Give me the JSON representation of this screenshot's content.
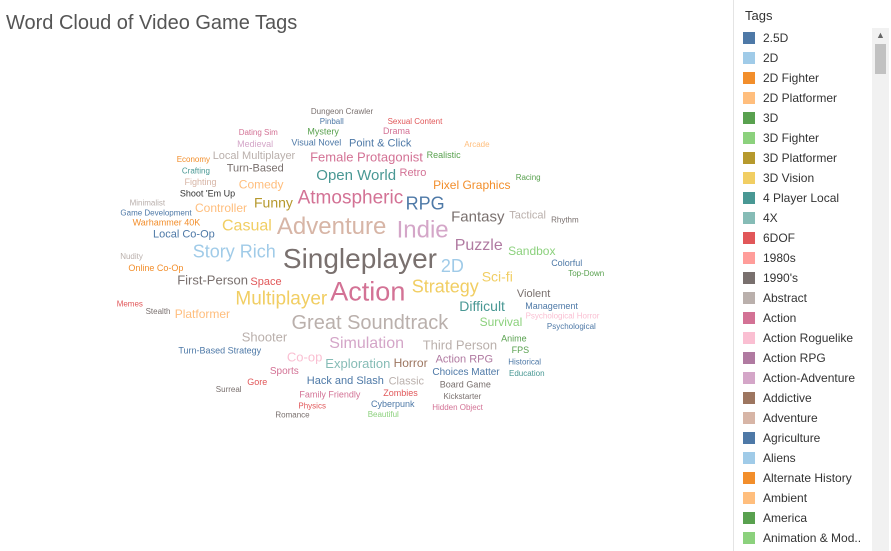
{
  "chart_data": {
    "type": "wordcloud",
    "title": "Word Cloud of Video Game Tags",
    "legend_title": "Tags",
    "legend": [
      {
        "label": "2.5D",
        "color": "#4e79a7"
      },
      {
        "label": "2D",
        "color": "#a0cbe8"
      },
      {
        "label": "2D Fighter",
        "color": "#f28e2b"
      },
      {
        "label": "2D Platformer",
        "color": "#ffbe7d"
      },
      {
        "label": "3D",
        "color": "#59a14f"
      },
      {
        "label": "3D Fighter",
        "color": "#8cd17d"
      },
      {
        "label": "3D Platformer",
        "color": "#b6992d"
      },
      {
        "label": "3D Vision",
        "color": "#f1ce63"
      },
      {
        "label": "4 Player Local",
        "color": "#499894"
      },
      {
        "label": "4X",
        "color": "#86bcb6"
      },
      {
        "label": "6DOF",
        "color": "#e15759"
      },
      {
        "label": "1980s",
        "color": "#ff9d9a"
      },
      {
        "label": "1990's",
        "color": "#79706e"
      },
      {
        "label": "Abstract",
        "color": "#bab0ac"
      },
      {
        "label": "Action",
        "color": "#d37295"
      },
      {
        "label": "Action Roguelike",
        "color": "#fabfd2"
      },
      {
        "label": "Action RPG",
        "color": "#b07aa1"
      },
      {
        "label": "Action-Adventure",
        "color": "#d4a6c8"
      },
      {
        "label": "Addictive",
        "color": "#9d7660"
      },
      {
        "label": "Adventure",
        "color": "#d7b5a6"
      },
      {
        "label": "Agriculture",
        "color": "#4e79a7"
      },
      {
        "label": "Aliens",
        "color": "#a0cbe8"
      },
      {
        "label": "Alternate History",
        "color": "#f28e2b"
      },
      {
        "label": "Ambient",
        "color": "#ffbe7d"
      },
      {
        "label": "America",
        "color": "#59a14f"
      },
      {
        "label": "Animation & Mod..",
        "color": "#8cd17d"
      }
    ],
    "words": [
      {
        "text": "Singleplayer",
        "size": 28,
        "color": "#79706e"
      },
      {
        "text": "Action",
        "size": 27,
        "color": "#d37295"
      },
      {
        "text": "Adventure",
        "size": 24,
        "color": "#d7b5a6"
      },
      {
        "text": "Indie",
        "size": 24,
        "color": "#d4a6c8"
      },
      {
        "text": "Great Soundtrack",
        "size": 20,
        "color": "#bab0ac"
      },
      {
        "text": "Multiplayer",
        "size": 19,
        "color": "#f1ce63"
      },
      {
        "text": "Atmospheric",
        "size": 19,
        "color": "#d37295"
      },
      {
        "text": "Strategy",
        "size": 18,
        "color": "#f1ce63"
      },
      {
        "text": "2D",
        "size": 18,
        "color": "#a0cbe8"
      },
      {
        "text": "Story Rich",
        "size": 18,
        "color": "#a0cbe8"
      },
      {
        "text": "RPG",
        "size": 18,
        "color": "#4e79a7"
      },
      {
        "text": "Puzzle",
        "size": 16,
        "color": "#b07aa1"
      },
      {
        "text": "Simulation",
        "size": 16,
        "color": "#d4a6c8"
      },
      {
        "text": "Casual",
        "size": 16,
        "color": "#f1ce63"
      },
      {
        "text": "Open World",
        "size": 15,
        "color": "#499894"
      },
      {
        "text": "Fantasy",
        "size": 15,
        "color": "#79706e"
      },
      {
        "text": "Funny",
        "size": 14,
        "color": "#b6992d"
      },
      {
        "text": "Sci-fi",
        "size": 14,
        "color": "#f1ce63"
      },
      {
        "text": "Difficult",
        "size": 14,
        "color": "#499894"
      },
      {
        "text": "First-Person",
        "size": 13,
        "color": "#79706e"
      },
      {
        "text": "Exploration",
        "size": 13,
        "color": "#86bcb6"
      },
      {
        "text": "Shooter",
        "size": 13,
        "color": "#bab0ac"
      },
      {
        "text": "Female Protagonist",
        "size": 13,
        "color": "#d37295"
      },
      {
        "text": "Third Person",
        "size": 13,
        "color": "#bab0ac"
      },
      {
        "text": "Co-op",
        "size": 13,
        "color": "#fabfd2"
      },
      {
        "text": "Comedy",
        "size": 12,
        "color": "#ffbe7d"
      },
      {
        "text": "Pixel Graphics",
        "size": 12,
        "color": "#f28e2b"
      },
      {
        "text": "Controller",
        "size": 12,
        "color": "#ffbe7d"
      },
      {
        "text": "Survival",
        "size": 12,
        "color": "#8cd17d"
      },
      {
        "text": "Platformer",
        "size": 12,
        "color": "#ffbe7d"
      },
      {
        "text": "Sandbox",
        "size": 12,
        "color": "#8cd17d"
      },
      {
        "text": "Horror",
        "size": 12,
        "color": "#9d7660"
      },
      {
        "text": "Action RPG",
        "size": 11,
        "color": "#b07aa1"
      },
      {
        "text": "Violent",
        "size": 11,
        "color": "#79706e"
      },
      {
        "text": "Hack and Slash",
        "size": 11,
        "color": "#4e79a7"
      },
      {
        "text": "Local Co-Op",
        "size": 11,
        "color": "#4e79a7"
      },
      {
        "text": "Turn-Based",
        "size": 11,
        "color": "#79706e"
      },
      {
        "text": "Tactical",
        "size": 11,
        "color": "#bab0ac"
      },
      {
        "text": "Space",
        "size": 11,
        "color": "#e15759"
      },
      {
        "text": "Retro",
        "size": 11,
        "color": "#d37295"
      },
      {
        "text": "Point & Click",
        "size": 11,
        "color": "#4e79a7"
      },
      {
        "text": "Classic",
        "size": 11,
        "color": "#bab0ac"
      },
      {
        "text": "Local Multiplayer",
        "size": 11,
        "color": "#bab0ac"
      },
      {
        "text": "Choices Matter",
        "size": 10,
        "color": "#4e79a7"
      },
      {
        "text": "Sports",
        "size": 10,
        "color": "#d37295"
      },
      {
        "text": "Shoot 'Em Up",
        "size": 9,
        "color": "#333333"
      },
      {
        "text": "Turn-Based Strategy",
        "size": 9,
        "color": "#4e79a7"
      },
      {
        "text": "Realistic",
        "size": 9,
        "color": "#59a14f"
      },
      {
        "text": "Visual Novel",
        "size": 9,
        "color": "#4e79a7"
      },
      {
        "text": "Management",
        "size": 9,
        "color": "#4e79a7"
      },
      {
        "text": "Anime",
        "size": 9,
        "color": "#59a14f"
      },
      {
        "text": "Zombies",
        "size": 9,
        "color": "#e15759"
      },
      {
        "text": "Family Friendly",
        "size": 9,
        "color": "#d37295"
      },
      {
        "text": "Online Co-Op",
        "size": 9,
        "color": "#f28e2b"
      },
      {
        "text": "Warhammer 40K",
        "size": 9,
        "color": "#f28e2b"
      },
      {
        "text": "Fighting",
        "size": 9,
        "color": "#d7b5a6"
      },
      {
        "text": "Colorful",
        "size": 9,
        "color": "#4e79a7"
      },
      {
        "text": "FPS",
        "size": 9,
        "color": "#59a14f"
      },
      {
        "text": "Gore",
        "size": 9,
        "color": "#e15759"
      },
      {
        "text": "Mystery",
        "size": 9,
        "color": "#59a14f"
      },
      {
        "text": "Drama",
        "size": 9,
        "color": "#d37295"
      },
      {
        "text": "Board Game",
        "size": 9,
        "color": "#79706e"
      },
      {
        "text": "Medieval",
        "size": 9,
        "color": "#d4a6c8"
      },
      {
        "text": "Cyberpunk",
        "size": 9,
        "color": "#4e79a7"
      },
      {
        "text": "Stealth",
        "size": 8,
        "color": "#79706e"
      },
      {
        "text": "Racing",
        "size": 8,
        "color": "#59a14f"
      },
      {
        "text": "Rhythm",
        "size": 8,
        "color": "#79706e"
      },
      {
        "text": "Psychological Horror",
        "size": 8,
        "color": "#fabfd2"
      },
      {
        "text": "Game Development",
        "size": 8,
        "color": "#4e79a7"
      },
      {
        "text": "Crafting",
        "size": 8,
        "color": "#499894"
      },
      {
        "text": "Arcade",
        "size": 8,
        "color": "#ffbe7d"
      },
      {
        "text": "Historical",
        "size": 8,
        "color": "#4e79a7"
      },
      {
        "text": "Physics",
        "size": 8,
        "color": "#e15759"
      },
      {
        "text": "Pinball",
        "size": 8,
        "color": "#4e79a7"
      },
      {
        "text": "Top-Down",
        "size": 8,
        "color": "#59a14f"
      },
      {
        "text": "Kickstarter",
        "size": 8,
        "color": "#79706e"
      },
      {
        "text": "Nudity",
        "size": 8,
        "color": "#bab0ac"
      },
      {
        "text": "Dating Sim",
        "size": 8,
        "color": "#d37295"
      },
      {
        "text": "Sexual Content",
        "size": 8,
        "color": "#e15759"
      },
      {
        "text": "Psychological",
        "size": 8,
        "color": "#4e79a7"
      },
      {
        "text": "Beautiful",
        "size": 8,
        "color": "#8cd17d"
      },
      {
        "text": "Surreal",
        "size": 8,
        "color": "#79706e"
      },
      {
        "text": "Minimalist",
        "size": 8,
        "color": "#bab0ac"
      },
      {
        "text": "Education",
        "size": 8,
        "color": "#499894"
      },
      {
        "text": "Economy",
        "size": 8,
        "color": "#f28e2b"
      },
      {
        "text": "Dungeon Crawler",
        "size": 8,
        "color": "#79706e"
      },
      {
        "text": "Hidden Object",
        "size": 8,
        "color": "#d37295"
      },
      {
        "text": "Memes",
        "size": 8,
        "color": "#e15759"
      },
      {
        "text": "Romance",
        "size": 8,
        "color": "#79706e"
      }
    ]
  }
}
